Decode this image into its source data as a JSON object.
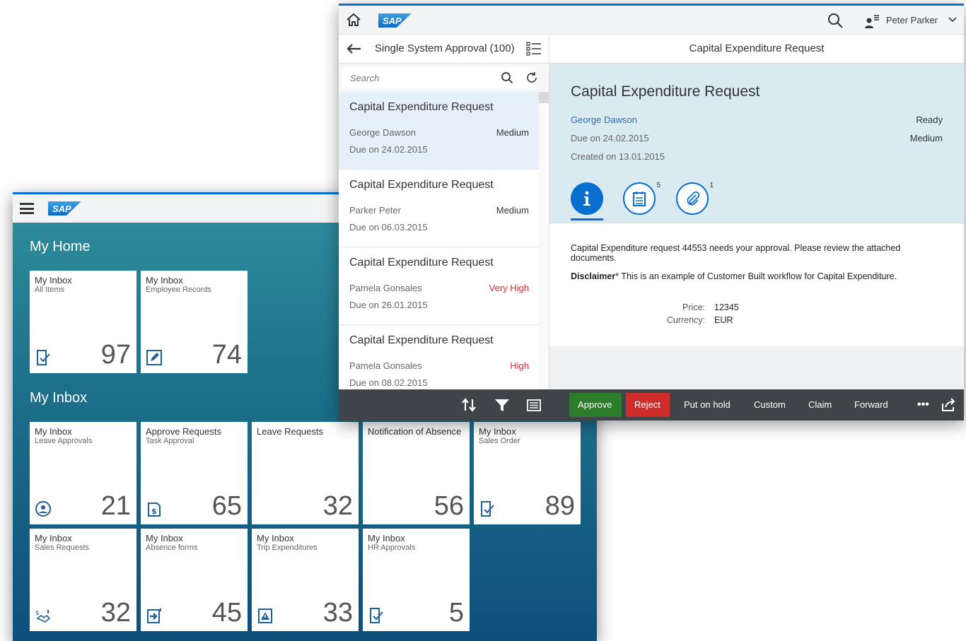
{
  "launchpad": {
    "sections": {
      "home": "My Home",
      "inbox": "My Inbox"
    },
    "home_tiles": [
      {
        "title": "My Inbox",
        "subtitle": "All Items",
        "count": "97",
        "icon": "task-check-icon"
      },
      {
        "title": "My Inbox",
        "subtitle": "Employee Records",
        "count": "74",
        "icon": "edit-icon"
      }
    ],
    "inbox_tiles": [
      {
        "title": "My Inbox",
        "subtitle": "Leave Approvals",
        "count": "21",
        "icon": "person-sync-icon"
      },
      {
        "title": "Approve Requests",
        "subtitle": "Task Approval",
        "count": "65",
        "icon": "money-doc-icon"
      },
      {
        "title": "Leave Requests",
        "subtitle": "",
        "count": "32",
        "icon": ""
      },
      {
        "title": "Notification of Absence",
        "subtitle": "",
        "count": "56",
        "icon": ""
      },
      {
        "title": "My Inbox",
        "subtitle": "Sales Order",
        "count": "89",
        "icon": "task-check-icon"
      },
      {
        "title": "My Inbox",
        "subtitle": "Sales Requests",
        "count": "32",
        "icon": "deal-icon"
      },
      {
        "title": "My Inbox",
        "subtitle": "Absence forms",
        "count": "45",
        "icon": "sign-in-icon"
      },
      {
        "title": "My Inbox",
        "subtitle": "Trip Expenditures",
        "count": "33",
        "icon": "warning-doc-icon"
      },
      {
        "title": "My Inbox",
        "subtitle": "HR Approvals",
        "count": "5",
        "icon": "task-check-icon"
      }
    ]
  },
  "shell": {
    "logo": "SAP",
    "user": "Peter Parker"
  },
  "master": {
    "title": "Single System Approval (100)",
    "search_placeholder": "Search",
    "items": [
      {
        "title": "Capital Expenditure Request",
        "name": "George Dawson",
        "priority": "Medium",
        "due": "Due on 24.02.2015"
      },
      {
        "title": "Capital Expenditure Request",
        "name": "Parker Peter",
        "priority": "Medium",
        "due": "Due on 06.03.2015"
      },
      {
        "title": "Capital Expenditure Request",
        "name": "Pamela Gonsales",
        "priority": "Very High",
        "due": "Due on 26.01.2015"
      },
      {
        "title": "Capital Expenditure Request",
        "name": "Pamela Gonsales",
        "priority": "High",
        "due": "Due on 08.02.2015"
      }
    ]
  },
  "detail": {
    "header": "Capital Expenditure Request",
    "object_title": "Capital Expenditure Request",
    "requester": "George Dawson",
    "status": "Ready",
    "due": "Due on 24.02.2015",
    "priority": "Medium",
    "created": "Created on 13.01.2015",
    "tabs": {
      "notes_count": "5",
      "attachments_count": "1"
    },
    "description": "Capital Expenditure request 44553 needs your approval. Please review the attached documents.",
    "disclaimer_label": "Disclaimer",
    "disclaimer_text": "* This is an example of Customer Built workflow for Capital Expenditure.",
    "fields": {
      "price_label": "Price:",
      "price_value": "12345",
      "currency_label": "Currency:",
      "currency_value": "EUR"
    }
  },
  "footer": {
    "approve": "Approve",
    "reject": "Reject",
    "hold": "Put on hold",
    "custom": "Custom",
    "claim": "Claim",
    "forward": "Forward",
    "more": "•••"
  },
  "colors": {
    "brand": "#0a6ed1",
    "approve": "#2b7d2b",
    "reject": "#d02c2c",
    "priority_high": "#e52929"
  }
}
